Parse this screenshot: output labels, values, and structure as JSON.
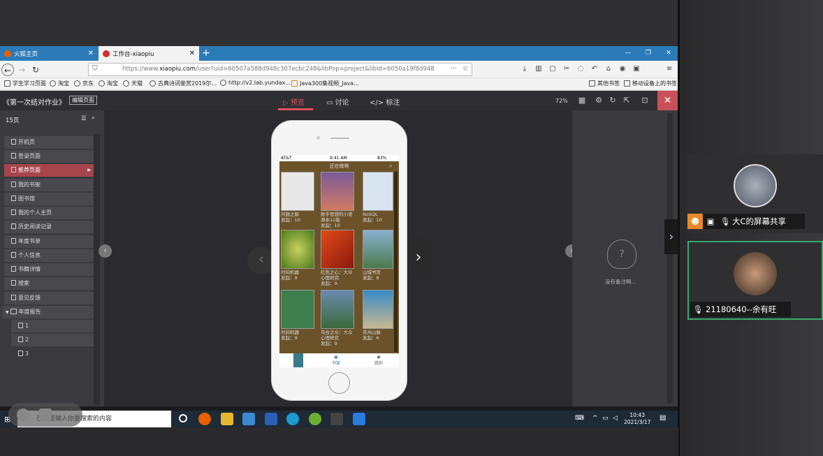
{
  "browser": {
    "tabs": [
      {
        "label": "火狐主页"
      },
      {
        "label": "工作台-xiaopiu"
      }
    ],
    "url_scheme": "https://www.",
    "url_domain": "xiaopiu.com",
    "url_rest": "/user?uid=60507a588d948c307ecbc248&libPop=project&libId=6050a19f8d948",
    "bookmarks": [
      "学生学习页面",
      "淘宝",
      "京东",
      "淘宝",
      "淘宝",
      "天猫",
      "古典诗词鉴赏2019尔...",
      "http://v2.lab.yundax...",
      "Java300集视频_Java..."
    ],
    "other_bookmarks": "其他书签",
    "mobile_bookmarks": "移动设备上的书签"
  },
  "app": {
    "doc_title": "《第一次结对作业》",
    "edit_button": "编辑页面",
    "tabs": [
      "预览",
      "讨论",
      "标注"
    ],
    "zoom": "72%",
    "page_count": "15页",
    "pages": [
      "开机页",
      "登录页面",
      "推荐页面",
      "我的书架",
      "图书馆",
      "我的个人主页",
      "历史阅读记录",
      "年度书单",
      "个人信息",
      "书籍详情",
      "搜索",
      "意见反馈",
      "年度报告",
      "1",
      "2",
      "3"
    ],
    "notes_empty": "没有备注啊..."
  },
  "phone": {
    "status_carrier": "AT&T",
    "status_time": "9:41 AM",
    "status_battery": "83%",
    "title": "还在做啊",
    "books": [
      {
        "title": "问题之解",
        "count": "发起：10",
        "color": "#e8e8e8"
      },
      {
        "title": "数字思想的小资源本12版",
        "count": "发起：10",
        "color": "#8a5a8a"
      },
      {
        "title": "NoSQL",
        "count": "发起：10",
        "color": "#d8e4f0"
      },
      {
        "title": "时间机器",
        "count": "发起：9",
        "color": "#6e9a2a"
      },
      {
        "title": "红色之心：大众心理研究",
        "count": "发起：9",
        "color": "#c0351d"
      },
      {
        "title": "山城书页",
        "count": "发起：8",
        "color": "#4a7a5a"
      },
      {
        "title": "时间机器",
        "count": "发起：9",
        "color": "#3e7e4e"
      },
      {
        "title": "鸟合之众：大众心理研究",
        "count": "发起：9",
        "color": "#6a8ab0"
      },
      {
        "title": "苏州山脉",
        "count": "发起：6",
        "color": "#3a8ac8"
      }
    ],
    "nav": [
      "",
      "书架",
      "我的"
    ]
  },
  "taskbar": {
    "search_placeholder": "在这里输入你要搜索的内容",
    "time": "10:43",
    "date": "2021/3/17"
  },
  "meeting": {
    "sharer_label": "大C的屏幕共享",
    "participant_label": "21180640--余有旺"
  }
}
